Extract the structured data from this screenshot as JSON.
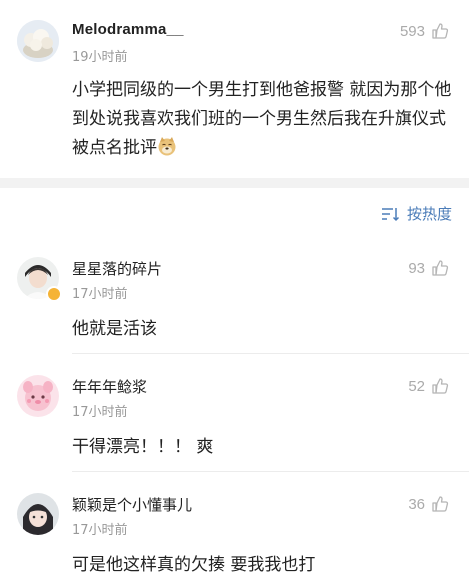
{
  "main_post": {
    "username": "Melodramma__",
    "time": "19小时前",
    "likes": "593",
    "text": "小学把同级的一个男生打到他爸报警 就因为那个他到处说我喜欢我们班的一个男生然后我在升旗仪式被点名批评"
  },
  "sort": {
    "label": "按热度"
  },
  "comments": [
    {
      "username": "星星落的碎片",
      "time": "17小时前",
      "likes": "93",
      "text": "他就是活该"
    },
    {
      "username": "年年年鲶浆",
      "time": "17小时前",
      "likes": "52",
      "text": "干得漂亮！！！ 爽"
    },
    {
      "username": "颖颖是个小懂事儿",
      "time": "17小时前",
      "likes": "36",
      "text": "可是他这样真的欠揍 要我我也打"
    }
  ],
  "colors": {
    "link_blue": "#4b7cb8",
    "meta_gray": "#999999",
    "divider": "#f2f2f2"
  }
}
